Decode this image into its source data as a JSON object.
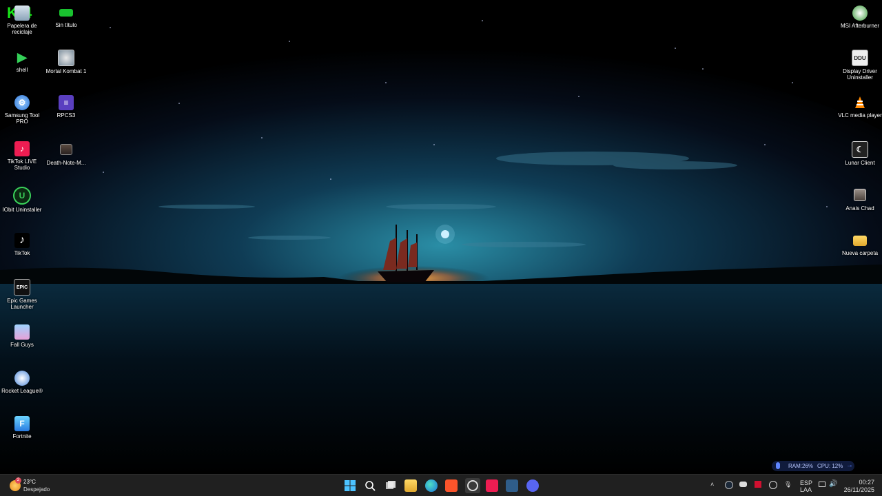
{
  "overlay": {
    "text": "K 4"
  },
  "desktop_left_col1": [
    {
      "label": "Papelera de reciclaje",
      "icon": "recycle-bin-icon"
    },
    {
      "label": "shell",
      "icon": "shell-play-icon"
    },
    {
      "label": "Samsung Tool PRO",
      "icon": "gear-icon"
    },
    {
      "label": "TikTok LIVE Studio",
      "icon": "tiktok-live-icon"
    },
    {
      "label": "IObit Uninstaller",
      "icon": "iobit-icon"
    },
    {
      "label": "TikTok",
      "icon": "tiktok-icon"
    },
    {
      "label": "Epic Games Launcher",
      "icon": "epic-games-icon"
    },
    {
      "label": "Fall Guys",
      "icon": "fall-guys-icon"
    },
    {
      "label": "Rocket League®",
      "icon": "rocket-league-icon"
    },
    {
      "label": "Fortnite",
      "icon": "fortnite-icon"
    }
  ],
  "desktop_left_col2": [
    {
      "label": "Sin título",
      "icon": "battery-icon"
    },
    {
      "label": "Mortal Kombat 1",
      "icon": "mortal-kombat-icon"
    },
    {
      "label": "RPCS3",
      "icon": "rpcs3-icon"
    },
    {
      "label": "Death-Note-M...",
      "icon": "image-file-icon"
    }
  ],
  "desktop_right": [
    {
      "label": "MSI Afterburner",
      "icon": "msi-afterburner-icon"
    },
    {
      "label": "Display Driver Uninstaller",
      "icon": "ddu-icon"
    },
    {
      "label": "VLC media player",
      "icon": "vlc-cone-icon"
    },
    {
      "label": "Lunar Client",
      "icon": "lunar-client-icon"
    },
    {
      "label": "Anais Chad",
      "icon": "image-file-icon"
    },
    {
      "label": "Nueva carpeta",
      "icon": "folder-icon"
    }
  ],
  "perf_widget": {
    "ram": "RAM:26%",
    "cpu": "CPU: 12%"
  },
  "taskbar": {
    "weather": {
      "temp": "23°C",
      "condition": "Despejado",
      "badge": "2"
    },
    "apps": [
      "start-icon",
      "search-icon",
      "task-view-icon",
      "file-explorer-icon",
      "edge-icon",
      "brave-icon",
      "obs-icon",
      "tiktok-live-icon",
      "vegas-icon",
      "discord-icon"
    ],
    "tray": {
      "lang1": "ESP",
      "lang2": "LAA",
      "time": "00:27",
      "date": "26/11/2025"
    }
  },
  "colors": {
    "taskbar": "#202020",
    "sky_top": "#000000",
    "sky_glow": "#1c6f86",
    "sunset": "#ff8a2a"
  }
}
